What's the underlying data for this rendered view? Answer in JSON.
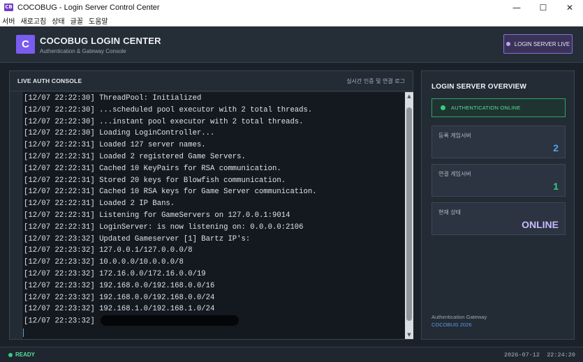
{
  "window": {
    "icon_text": "CB",
    "title": "COCOBUG - Login Server Control Center",
    "minimize": "—",
    "maximize": "☐",
    "close": "✕"
  },
  "menu": [
    "서버",
    "새로고침",
    "상태",
    "글꼴",
    "도움말"
  ],
  "header": {
    "logo_letter": "C",
    "title": "COCOBUG LOGIN CENTER",
    "subtitle": "Authentication & Gateway Console",
    "live_button": "LOGIN SERVER LIVE"
  },
  "console": {
    "title": "LIVE AUTH CONSOLE",
    "hint": "실시간 인증 및 연결 로그",
    "lines": [
      {
        "time": "[12/07 22:22:30]",
        "msg": "ThreadPool: Initialized"
      },
      {
        "time": "[12/07 22:22:30]",
        "msg": "...scheduled pool executor with 2 total threads."
      },
      {
        "time": "[12/07 22:22:30]",
        "msg": "...instant pool executor with 2 total threads."
      },
      {
        "time": "[12/07 22:22:30]",
        "msg": "Loading LoginController..."
      },
      {
        "time": "[12/07 22:22:31]",
        "msg": "Loaded 127 server names."
      },
      {
        "time": "[12/07 22:22:31]",
        "msg": "Loaded 2 registered Game Servers."
      },
      {
        "time": "[12/07 22:22:31]",
        "msg": "Cached 10 KeyPairs for RSA communication."
      },
      {
        "time": "[12/07 22:22:31]",
        "msg": "Stored 20 keys for Blowfish communication."
      },
      {
        "time": "[12/07 22:22:31]",
        "msg": "Cached 10 RSA keys for Game Server communication."
      },
      {
        "time": "[12/07 22:22:31]",
        "msg": "Loaded 2 IP Bans."
      },
      {
        "time": "[12/07 22:22:31]",
        "msg": "Listening for GameServers on 127.0.0.1:9014"
      },
      {
        "time": "[12/07 22:22:31]",
        "msg": "LoginServer: is now listening on: 0.0.0.0:2106"
      },
      {
        "time": "[12/07 22:23:32]",
        "msg": "Updated Gameserver [1] Bartz IP's:"
      },
      {
        "time": "[12/07 22:23:32]",
        "msg": "127.0.0.1/127.0.0.0/8"
      },
      {
        "time": "[12/07 22:23:32]",
        "msg": "10.0.0.0/10.0.0.0/8"
      },
      {
        "time": "[12/07 22:23:32]",
        "msg": "172.16.0.0/172.16.0.0/19"
      },
      {
        "time": "[12/07 22:23:32]",
        "msg": "192.168.0.0/192.168.0.0/16"
      },
      {
        "time": "[12/07 22:23:32]",
        "msg": "192.168.0.0/192.168.0.0/24"
      },
      {
        "time": "[12/07 22:23:32]",
        "msg": "192.168.1.0/192.168.1.0/24"
      },
      {
        "time": "[12/07 22:23:32]",
        "msg": ""
      }
    ]
  },
  "overview": {
    "title": "LOGIN SERVER OVERVIEW",
    "auth_status": "AUTHENTICATION ONLINE",
    "cards": [
      {
        "label": "등록 게임서버",
        "value": "2",
        "color": "#4fa3f0"
      },
      {
        "label": "연결 게임서버",
        "value": "1",
        "color": "#2fd07e"
      },
      {
        "label": "현재 상태",
        "value": "ONLINE",
        "color": "#c9b8ff"
      }
    ],
    "footer_line1": "Authentication Gateway",
    "footer_line2": "COCOBUG 2026"
  },
  "status": {
    "ready": "READY",
    "date": "2026-07-12",
    "time": "22:24:20"
  },
  "colors": {
    "accent": "#7a5cf0",
    "online_green": "#2fd07e",
    "link_blue": "#5a9be0"
  }
}
